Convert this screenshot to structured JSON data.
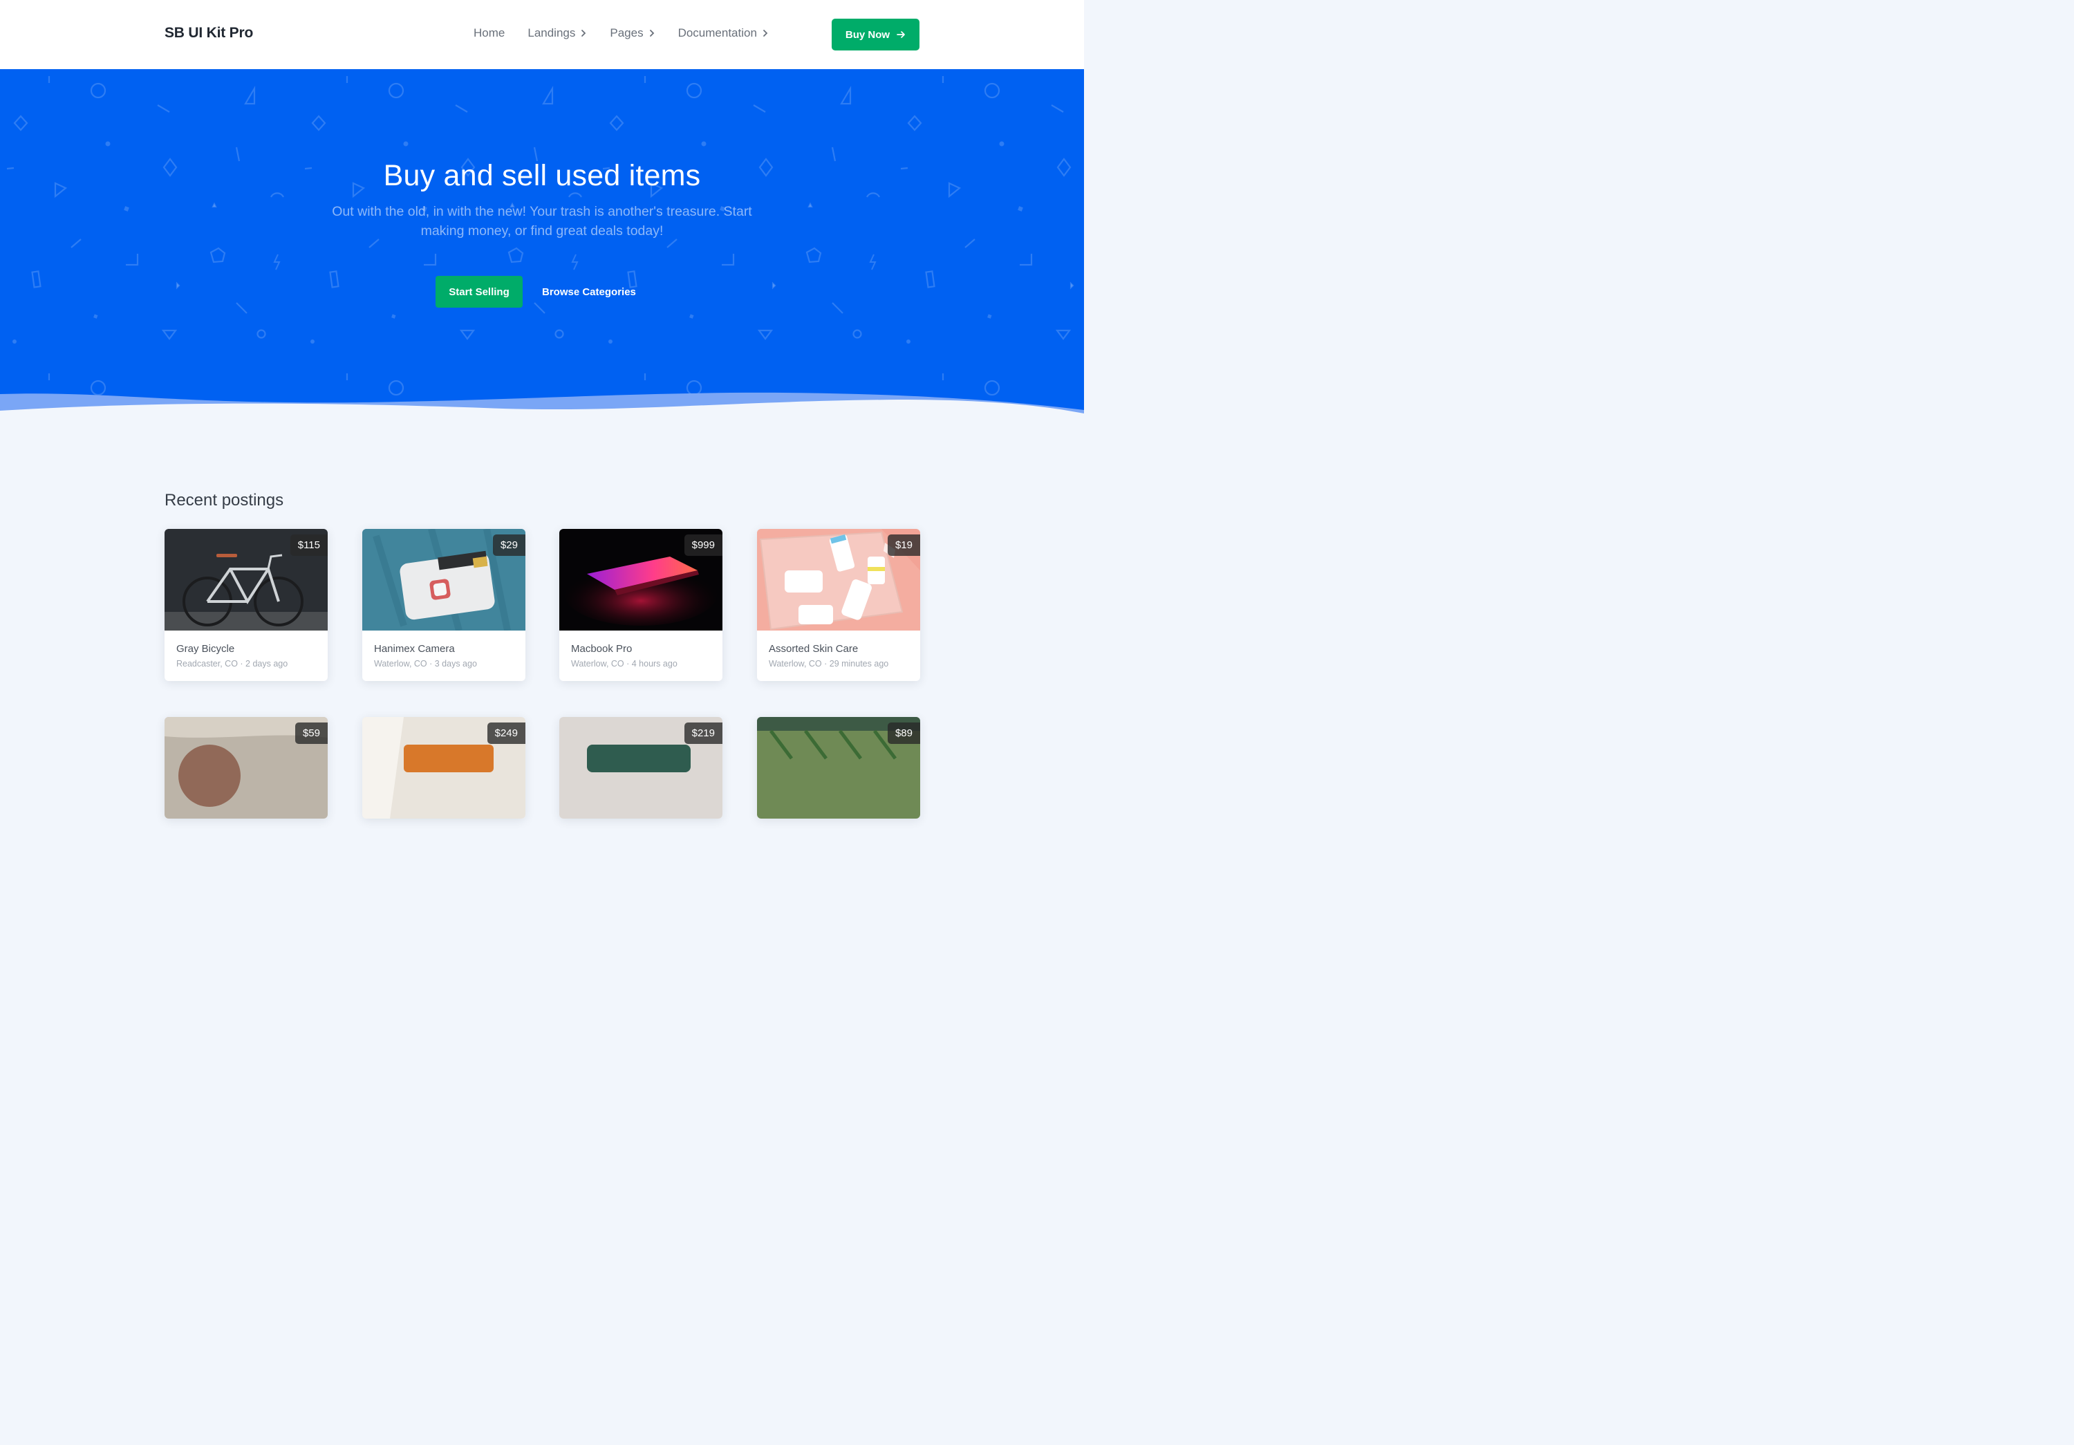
{
  "brand": "SB UI Kit Pro",
  "nav": {
    "items": [
      {
        "label": "Home",
        "has_dropdown": false
      },
      {
        "label": "Landings",
        "has_dropdown": true
      },
      {
        "label": "Pages",
        "has_dropdown": true
      },
      {
        "label": "Documentation",
        "has_dropdown": true
      }
    ],
    "buy_label": "Buy Now"
  },
  "hero": {
    "title": "Buy and sell used items",
    "subtitle": "Out with the old, in with the new! Your trash is another's treasure. Start making money, or find great deals today!",
    "primary_label": "Start Selling",
    "secondary_label": "Browse Categories"
  },
  "postings": {
    "title": "Recent postings",
    "items": [
      {
        "title": "Gray Bicycle",
        "meta": "Readcaster, CO · 2 days ago",
        "price": "$115",
        "image": "bicycle"
      },
      {
        "title": "Hanimex Camera",
        "meta": "Waterlow, CO · 3 days ago",
        "price": "$29",
        "image": "camera"
      },
      {
        "title": "Macbook Pro",
        "meta": "Waterlow, CO · 4 hours ago",
        "price": "$999",
        "image": "laptop"
      },
      {
        "title": "Assorted Skin Care",
        "meta": "Waterlow, CO · 29 minutes ago",
        "price": "$19",
        "image": "skincare"
      },
      {
        "price": "$59",
        "image": "leather-chair"
      },
      {
        "price": "$249",
        "image": "orange-sofa"
      },
      {
        "price": "$219",
        "image": "green-sofa"
      },
      {
        "price": "$89",
        "image": "green-chairs"
      }
    ]
  },
  "colors": {
    "primary": "#0061f2",
    "success": "#00ac69",
    "background": "#f2f6fc"
  }
}
